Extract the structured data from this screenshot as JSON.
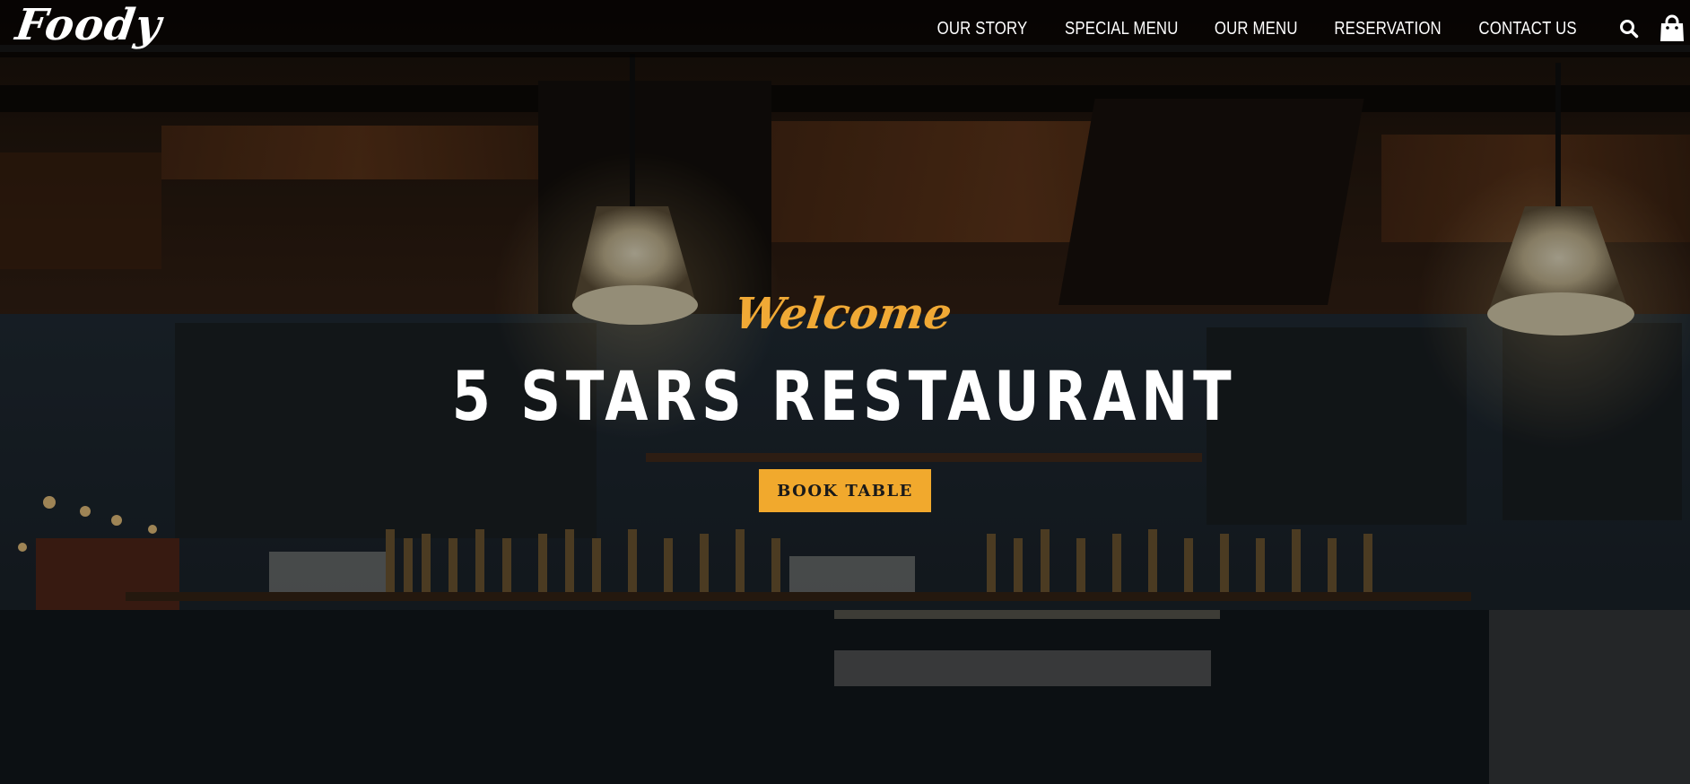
{
  "brand": {
    "logo_text": "Foody"
  },
  "nav": {
    "items": [
      {
        "label": "OUR STORY"
      },
      {
        "label": "SPECIAL MENU"
      },
      {
        "label": "OUR MENU"
      },
      {
        "label": "RESERVATION"
      },
      {
        "label": "CONTACT US"
      }
    ],
    "search_icon": "search-icon",
    "cart_icon": "shopping-bag-icon"
  },
  "hero": {
    "welcome": "Welcome",
    "headline": "5 STARS RESTAURANT",
    "cta_label": "BOOK TABLE"
  },
  "colors": {
    "accent": "#f1a92d",
    "welcome_text": "#f0a935",
    "nav_text": "#ffffff",
    "overlay": "#000000"
  }
}
